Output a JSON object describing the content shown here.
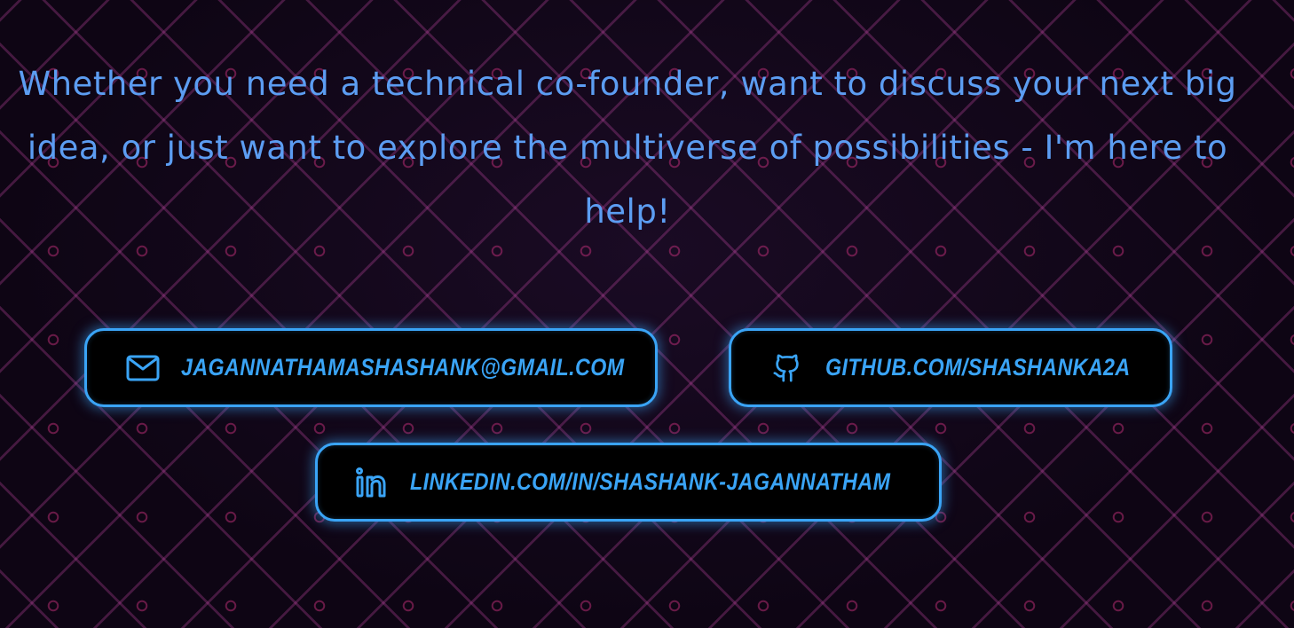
{
  "intro": {
    "text": "Whether you need a technical co-founder, want to discuss your next big idea, or just want to explore the multiverse of possibilities - I'm here to help!"
  },
  "contacts": {
    "email": {
      "label": "JAGANNATHAMASHASHANK@GMAIL.COM",
      "icon": "mail-icon"
    },
    "github": {
      "label": "GITHUB.COM/SHASHANKA2A",
      "icon": "github-icon"
    },
    "linkedin": {
      "label": "LINKEDIN.COM/IN/SHASHANK-JAGANNATHAM",
      "icon": "linkedin-icon"
    }
  },
  "colors": {
    "accent": "#3aa4f6",
    "intro_text": "#5c9df2",
    "background": "#0f0617",
    "grid_lines": "#c448a6"
  }
}
